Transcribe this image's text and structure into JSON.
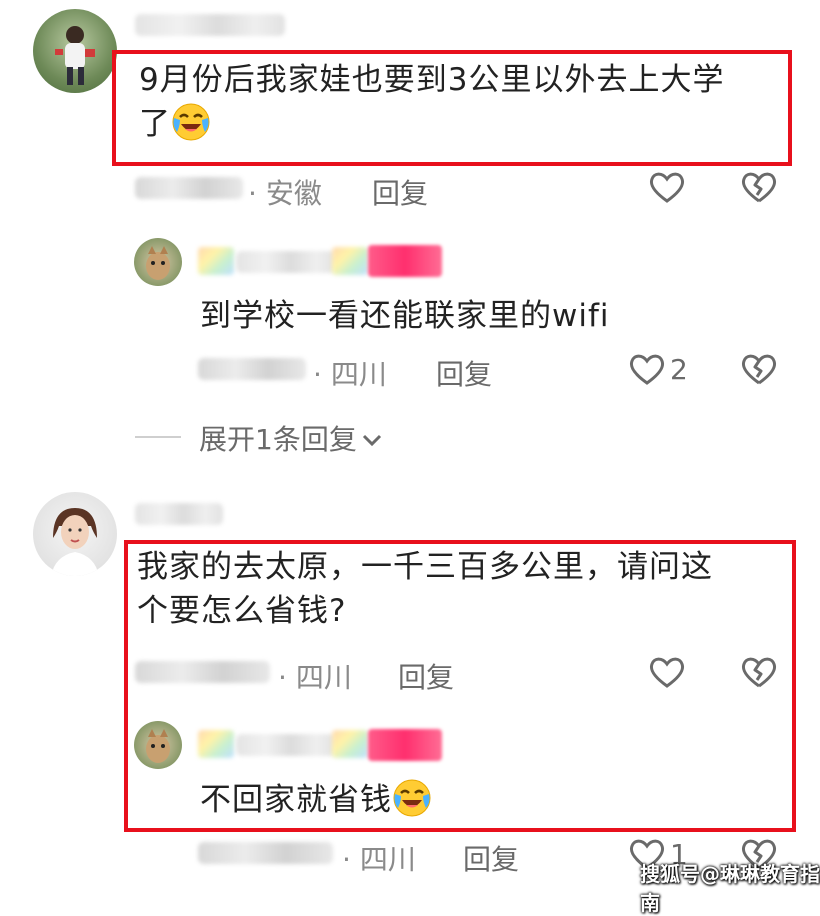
{
  "comments": [
    {
      "text_line1": "9月份后我家娃也要到3公里以外去上大学",
      "text_line2": "了",
      "location": "安徽",
      "reply_label": "回复",
      "likes": "",
      "reply": {
        "text": "到学校一看还能联家里的wifi",
        "location": "四川",
        "reply_label": "回复",
        "likes": "2"
      },
      "expand_label": "展开1条回复"
    },
    {
      "text_line1": "我家的去太原，一千三百多公里，请问这",
      "text_line2": "个要怎么省钱?",
      "location": "四川",
      "reply_label": "回复",
      "likes": "",
      "reply": {
        "text": "不回家就省钱",
        "location": "四川",
        "reply_label": "回复",
        "likes": "1"
      }
    }
  ],
  "meta_separator": "·",
  "watermark": "搜狐号@琳琳教育指南",
  "colors": {
    "highlight_border": "#e8101c",
    "meta_text": "#8a8a8a",
    "pink_tag": "#ff2f6e"
  },
  "icons": [
    "heart-outline-icon",
    "broken-heart-icon",
    "chevron-down-icon",
    "laughing-tears-emoji"
  ]
}
